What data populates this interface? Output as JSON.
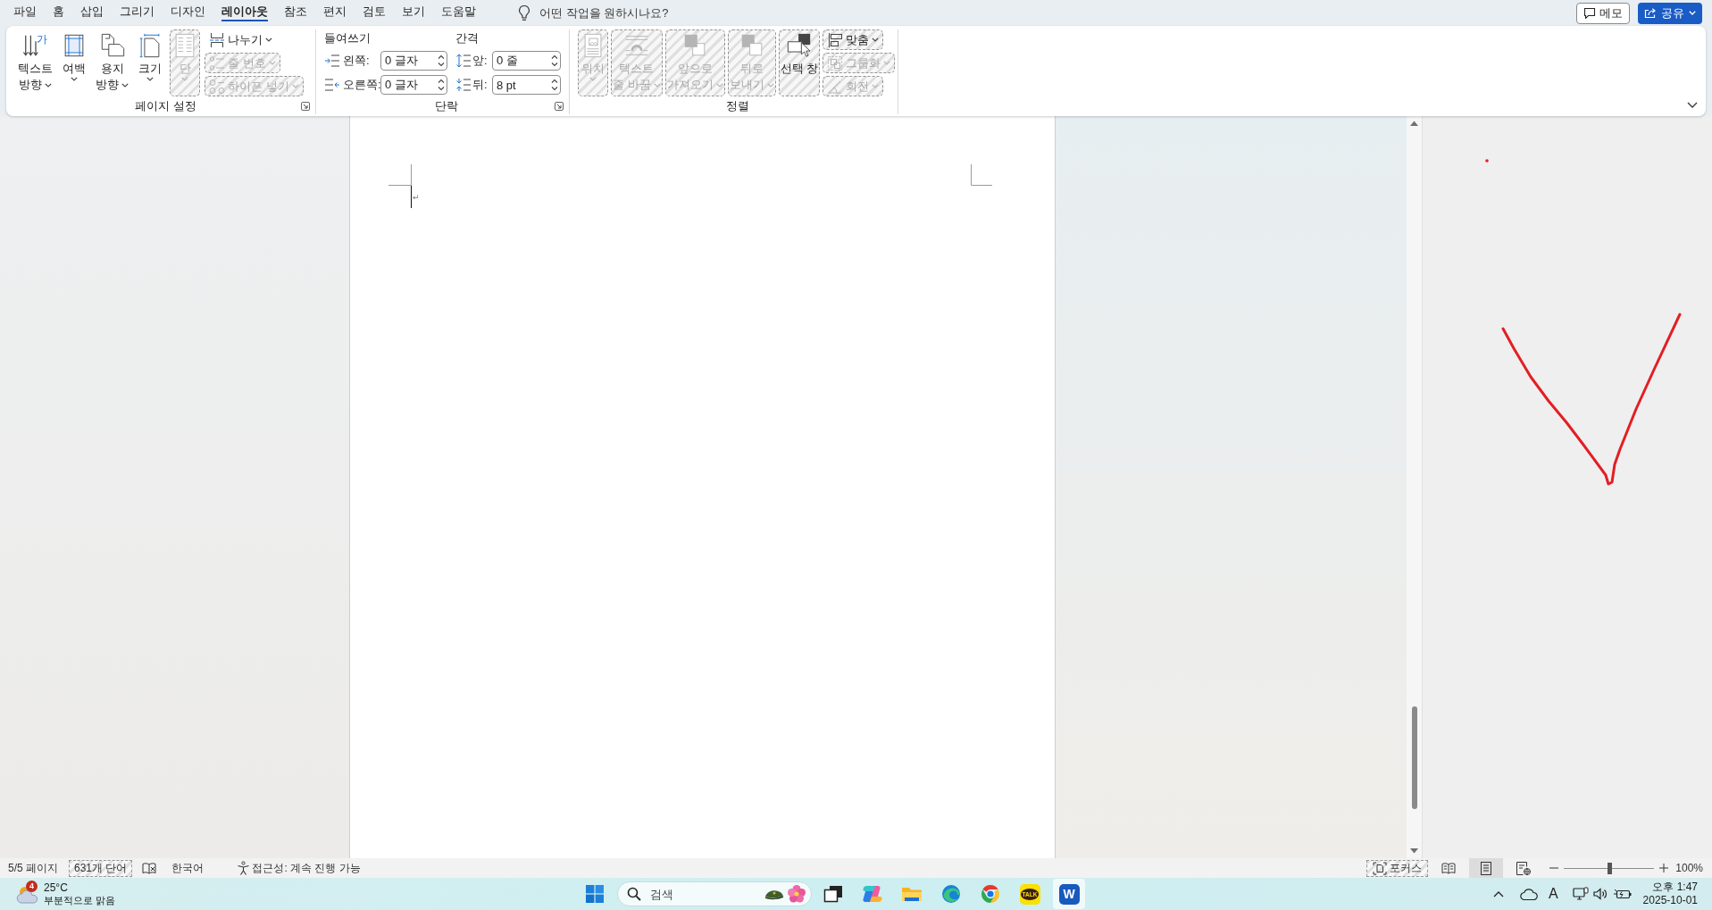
{
  "menu_bar": {
    "tabs": [
      {
        "label": "파일",
        "selected": false
      },
      {
        "label": "홈",
        "selected": false
      },
      {
        "label": "삽입",
        "selected": false
      },
      {
        "label": "그리기",
        "selected": false
      },
      {
        "label": "디자인",
        "selected": false
      },
      {
        "label": "레이아웃",
        "selected": true
      },
      {
        "label": "참조",
        "selected": false
      },
      {
        "label": "편지",
        "selected": false
      },
      {
        "label": "검토",
        "selected": false
      },
      {
        "label": "보기",
        "selected": false
      },
      {
        "label": "도움말",
        "selected": false
      }
    ],
    "tell_me": {
      "placeholder": "어떤 작업을 원하시나요?"
    },
    "comments_button": "메모",
    "share_button": "공유"
  },
  "ribbon": {
    "groups": [
      {
        "kind": "buttons",
        "label": "페이지 설정",
        "launcher": true,
        "buttons": [
          {
            "lines": [
              "텍스트",
              "방향"
            ],
            "icon_glyph": "가",
            "caret": true,
            "disabled": false,
            "hatched": false
          },
          {
            "lines": [
              "여백"
            ],
            "caret": true,
            "disabled": false,
            "hatched": false
          },
          {
            "lines": [
              "용지",
              "방향"
            ],
            "caret": true,
            "disabled": false,
            "hatched": false
          },
          {
            "lines": [
              "크기"
            ],
            "caret": true,
            "disabled": false,
            "hatched": false
          },
          {
            "lines": [
              "단"
            ],
            "caret": true,
            "disabled": true,
            "hatched": true
          }
        ],
        "small_buttons": [
          {
            "label": "나누기",
            "caret": true,
            "disabled": false,
            "hatched": false
          },
          {
            "label": "줄 번호",
            "caret": true,
            "disabled": true,
            "hatched": true
          },
          {
            "label": "하이픈 넣기",
            "caret": true,
            "disabled": true,
            "hatched": true
          }
        ]
      },
      {
        "kind": "fields",
        "label": "단락",
        "launcher": true,
        "columns": [
          {
            "heading": "들여쓰기",
            "fields": [
              {
                "label": "왼쪽:",
                "value": "0 글자"
              },
              {
                "label": "오른쪽:",
                "value": "0 글자"
              }
            ]
          },
          {
            "heading": "간격",
            "fields": [
              {
                "label": "앞:",
                "value": "0 줄"
              },
              {
                "label": "뒤:",
                "value": "8 pt"
              }
            ]
          }
        ]
      },
      {
        "kind": "buttons",
        "label": "정렬",
        "launcher": false,
        "buttons": [
          {
            "lines": [
              "위치"
            ],
            "caret": true,
            "disabled": true,
            "hatched": true
          },
          {
            "lines": [
              "텍스트",
              "줄 바꿈"
            ],
            "caret": true,
            "disabled": true,
            "hatched": true
          },
          {
            "lines": [
              "앞으로",
              "가져오기"
            ],
            "caret": true,
            "disabled": true,
            "hatched": true
          },
          {
            "lines": [
              "뒤로",
              "보내기"
            ],
            "caret": true,
            "disabled": true,
            "hatched": true
          },
          {
            "lines": [
              "선택 창"
            ],
            "caret": false,
            "disabled": false,
            "hatched": true
          }
        ],
        "small_buttons": [
          {
            "label": "맞춤",
            "caret": true,
            "disabled": false,
            "hatched": true
          },
          {
            "label": "그룹화",
            "caret": true,
            "disabled": true,
            "hatched": true
          },
          {
            "label": "회전",
            "caret": true,
            "disabled": true,
            "hatched": true
          }
        ]
      }
    ]
  },
  "document": {
    "paragraph_mark": "↵"
  },
  "status_bar": {
    "page": "5/5 페이지",
    "word_count": {
      "text": "631개 단어",
      "hatched": true
    },
    "language": "한국어",
    "accessibility": "접근성: 계속 진행 가능",
    "focus": {
      "label": "포커스",
      "hatched": true
    },
    "views": [
      {
        "selected": false
      },
      {
        "selected": true
      },
      {
        "selected": false
      }
    ],
    "zoom": {
      "level": 0.5,
      "reading": "100%"
    }
  },
  "taskbar": {
    "weather": {
      "badge": "4",
      "temperature": "25°C",
      "condition": "부분적으로 맑음"
    },
    "search": {
      "placeholder": "검색"
    },
    "apps": [
      {
        "kind": "task_view",
        "selected": false
      },
      {
        "kind": "assistant",
        "selected": false
      },
      {
        "kind": "folder",
        "selected": false
      },
      {
        "kind": "browser_wave",
        "selected": false
      },
      {
        "kind": "browser_ring",
        "selected": false
      },
      {
        "kind": "chat",
        "label": "TALK",
        "selected": false
      },
      {
        "kind": "writer",
        "label": "W",
        "selected": true
      }
    ],
    "tray": {
      "input_mode": "A"
    },
    "clock": {
      "time": "오후 1:47",
      "date": "2025-10-01"
    }
  }
}
